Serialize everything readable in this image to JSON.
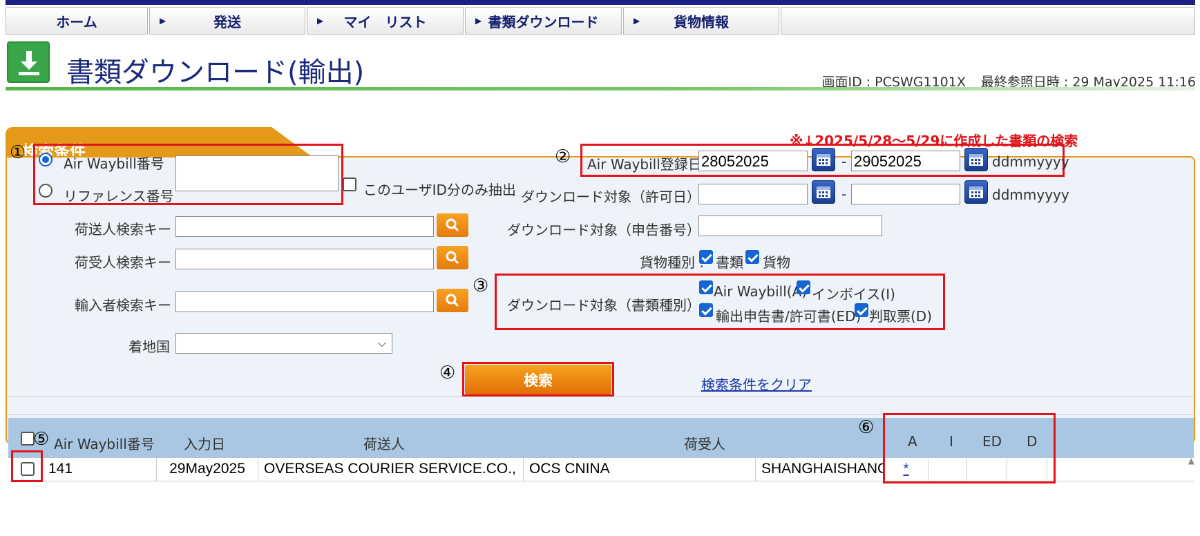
{
  "nav": {
    "home": "ホーム",
    "ship": "発送",
    "mylist": "マイ　リスト",
    "docdl": "書類ダウンロード",
    "cargo": "貨物情報"
  },
  "page": {
    "title": "書類ダウンロード(輸出)",
    "screen_id": "画面ID : PCSWG1101X",
    "last_ref": "最終参照日時 : 29 May2025 11:16"
  },
  "note": "※↓2025/5/28〜5/29に作成した書類の検索",
  "search": {
    "tab": "検索条件",
    "radio_awb": "Air Waybill番号",
    "radio_ref": "リファレンス番号",
    "awb_input": "",
    "only_user": "このユーザID分のみ抽出",
    "shipper_key": "荷送人検索キー :",
    "consignee_key": "荷受人検索キー :",
    "importer_key": "輸入者検索キー :",
    "destination": "着地国 :",
    "awb_date_label": "Air Waybill登録日 :",
    "awb_date_from": "28052025",
    "awb_date_to": "29052025",
    "date_format": "ddmmyyyy",
    "permit_label": "ダウンロード対象（許可日）:",
    "permit_from": "",
    "permit_to": "",
    "decl_label": "ダウンロード対象（申告番号）:",
    "cargo_type_label": "貨物種別 :",
    "cargo_docs": "書類",
    "cargo_goods": "貨物",
    "doc_type_label": "ダウンロード対象（書類種別）:",
    "doc_awb": "Air Waybill(A)",
    "doc_inv": "インボイス(I)",
    "doc_ed": "輸出申告書/許可書(ED)",
    "doc_d": "判取票(D)",
    "dash": "-",
    "search_button": "検索",
    "clear_link": "検索条件をクリア"
  },
  "markers": {
    "m1": "①",
    "m2": "②",
    "m3": "③",
    "m4": "④",
    "m5": "⑤",
    "m6": "⑥"
  },
  "table": {
    "headers": {
      "awb": "Air Waybill番号",
      "date": "入力日",
      "shipper": "荷送人",
      "consignee": "荷受人",
      "a": "A",
      "i": "I",
      "ed": "ED",
      "d": "D"
    },
    "rows": [
      {
        "awb": "141",
        "date": "29May2025",
        "shipper": "OVERSEAS COURIER SERVICE.CO.,",
        "consignee": "OCS CNINA",
        "dest": "SHANGHAISHANG",
        "a": "*"
      }
    ]
  }
}
